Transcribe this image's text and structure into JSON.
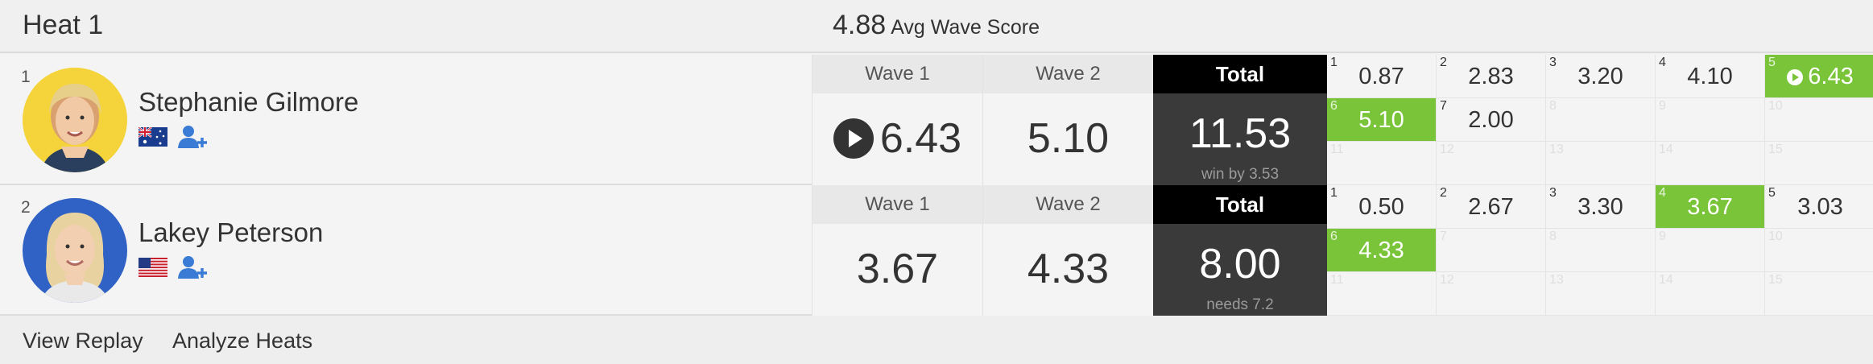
{
  "header": {
    "heat_title": "Heat 1",
    "avg_value": "4.88",
    "avg_label": "Avg Wave Score"
  },
  "athletes": [
    {
      "seed": "1",
      "name": "Stephanie Gilmore",
      "flag": "Australia",
      "avatar_color": "#f4d43a",
      "wave1_label": "Wave 1",
      "wave1_score": "6.43",
      "wave2_label": "Wave 2",
      "wave2_score": "5.10",
      "total_label": "Total",
      "total_score": "11.53",
      "total_sub": "win by 3.53",
      "waves": [
        {
          "n": "1",
          "v": "0.87",
          "hl": false
        },
        {
          "n": "2",
          "v": "2.83",
          "hl": false
        },
        {
          "n": "3",
          "v": "3.20",
          "hl": false
        },
        {
          "n": "4",
          "v": "4.10",
          "hl": false
        },
        {
          "n": "5",
          "v": "6.43",
          "hl": true,
          "play": true
        },
        {
          "n": "6",
          "v": "5.10",
          "hl": true
        },
        {
          "n": "7",
          "v": "2.00",
          "hl": false
        },
        {
          "n": "8",
          "v": "",
          "hl": false
        },
        {
          "n": "9",
          "v": "",
          "hl": false
        },
        {
          "n": "10",
          "v": "",
          "hl": false
        },
        {
          "n": "11",
          "v": "",
          "hl": false
        },
        {
          "n": "12",
          "v": "",
          "hl": false
        },
        {
          "n": "13",
          "v": "",
          "hl": false
        },
        {
          "n": "14",
          "v": "",
          "hl": false
        },
        {
          "n": "15",
          "v": "",
          "hl": false
        }
      ]
    },
    {
      "seed": "2",
      "name": "Lakey Peterson",
      "flag": "United States",
      "avatar_color": "#2f62c4",
      "wave1_label": "Wave 1",
      "wave1_score": "3.67",
      "wave2_label": "Wave 2",
      "wave2_score": "4.33",
      "total_label": "Total",
      "total_score": "8.00",
      "total_sub": "needs 7.2",
      "waves": [
        {
          "n": "1",
          "v": "0.50",
          "hl": false
        },
        {
          "n": "2",
          "v": "2.67",
          "hl": false
        },
        {
          "n": "3",
          "v": "3.30",
          "hl": false
        },
        {
          "n": "4",
          "v": "3.67",
          "hl": true
        },
        {
          "n": "5",
          "v": "3.03",
          "hl": false
        },
        {
          "n": "6",
          "v": "4.33",
          "hl": true
        },
        {
          "n": "7",
          "v": "",
          "hl": false
        },
        {
          "n": "8",
          "v": "",
          "hl": false
        },
        {
          "n": "9",
          "v": "",
          "hl": false
        },
        {
          "n": "10",
          "v": "",
          "hl": false
        },
        {
          "n": "11",
          "v": "",
          "hl": false
        },
        {
          "n": "12",
          "v": "",
          "hl": false
        },
        {
          "n": "13",
          "v": "",
          "hl": false
        },
        {
          "n": "14",
          "v": "",
          "hl": false
        },
        {
          "n": "15",
          "v": "",
          "hl": false
        }
      ]
    }
  ],
  "footer": {
    "view_replay": "View Replay",
    "analyze_heats": "Analyze Heats"
  },
  "colors": {
    "highlight": "#7ac43a",
    "total_bg": "#3a3a3a"
  },
  "icons": [
    "play-icon",
    "add-user-icon",
    "australia-flag-icon",
    "usa-flag-icon"
  ]
}
